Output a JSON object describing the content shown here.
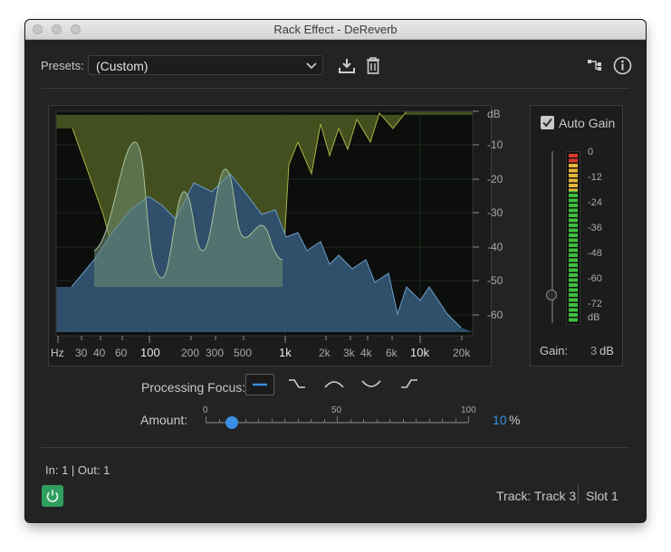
{
  "window": {
    "title": "Rack Effect - DeReverb"
  },
  "presets": {
    "label": "Presets:",
    "value": "(Custom)"
  },
  "graph": {
    "db_unit": "dB",
    "db_ticks": [
      "-10",
      "-20",
      "-30",
      "-40",
      "-50",
      "-60"
    ],
    "freq_unit": "Hz",
    "freq_ticks_minor": [
      "30",
      "40",
      "60",
      "200",
      "300",
      "500",
      "2k",
      "3k",
      "4k",
      "6k",
      "20k"
    ],
    "freq_ticks_major": [
      "100",
      "1k",
      "10k"
    ],
    "colors": {
      "spectrum": "#3a5f7f",
      "spectrum_line": "#6b9cc8",
      "reduction": "#5f6a2a",
      "reduction_line": "#b7c24e",
      "curve_fill": "#7a9a78"
    }
  },
  "gain": {
    "auto_gain_label": "Auto Gain",
    "auto_gain_checked": true,
    "meter_ticks": [
      "0",
      "-12",
      "-24",
      "-36",
      "-48",
      "-60",
      "-72",
      "dB"
    ],
    "gain_label": "Gain:",
    "gain_value": "3",
    "gain_unit": "dB"
  },
  "processing_focus": {
    "label": "Processing Focus:",
    "options": [
      "focus-evenly",
      "focus-high",
      "focus-mid",
      "focus-low-high",
      "focus-low"
    ],
    "selected": 0
  },
  "amount": {
    "label": "Amount:",
    "scale": [
      "0",
      "50",
      "100"
    ],
    "value": "10",
    "unit": "%",
    "fraction": 0.1
  },
  "footer": {
    "io": "In: 1 | Out: 1",
    "track": "Track: Track 3",
    "slot": "Slot 1",
    "power_color": "#2e9f5e"
  }
}
